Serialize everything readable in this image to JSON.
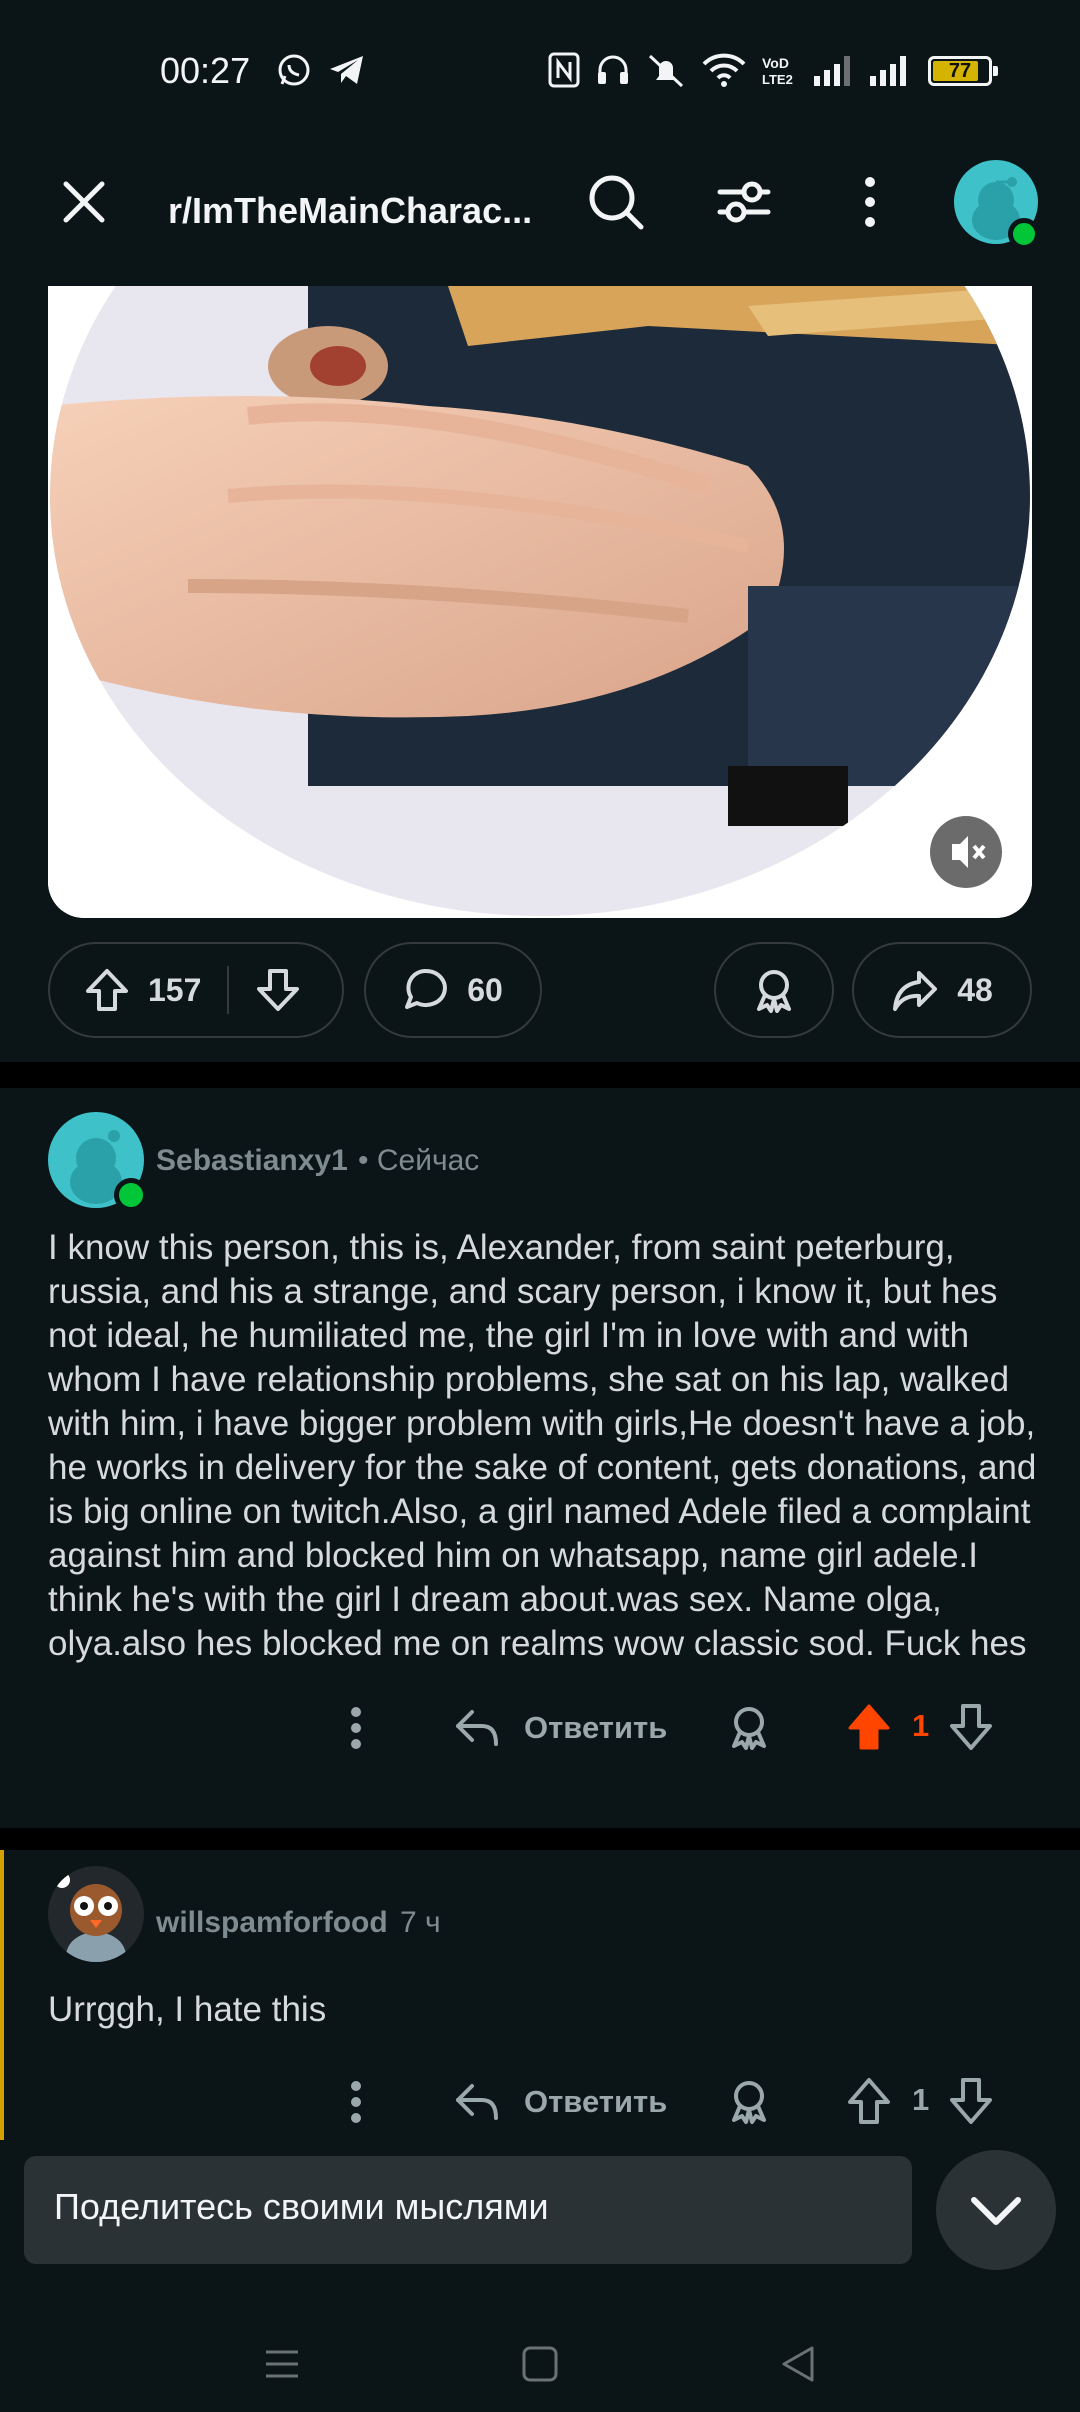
{
  "status_bar": {
    "time": "00:27",
    "battery": "77",
    "icons": [
      "whatsapp-icon",
      "telegram-icon",
      "nfc-icon",
      "headphones-icon",
      "mute-icon",
      "wifi-icon",
      "volte-icon",
      "signal-icon",
      "signal-icon",
      "battery-icon"
    ]
  },
  "header": {
    "title": "r/ImTheMainCharac..."
  },
  "post_actions": {
    "upvotes": "157",
    "comments": "60",
    "shares": "48"
  },
  "comments": [
    {
      "username": "Sebastianxy1",
      "meta": "• Сейчас",
      "text": "I know this person, this is, Alexander, from saint peterburg, russia, and his a strange, and scary person, i know it, but hes not ideal, he humiliated me, the girl I'm in love with and with whom I have relationship problems, she sat on his lap, walked with him, i have bigger problem with girls,He doesn't have a job, he works in delivery for the sake of content, gets donations, and is big online on twitch.Also, a girl named Adele filed a complaint against him and blocked him on whatsapp, name girl adele.I think he's with the girl I dream about.was sex. Name olga, olya.also hes blocked me on realms wow classic sod. Fuck hes",
      "reply_label": "Ответить",
      "score": "1"
    },
    {
      "username": "willspamforfood",
      "meta": "7 ч",
      "text": "Urrggh, I hate this",
      "reply_label": "Ответить",
      "score": "1"
    }
  ],
  "composer": {
    "placeholder": "Поделитесь своими мыслями"
  },
  "colors": {
    "background": "#0b1416",
    "upvote_active": "#ff4500",
    "online": "#00c638",
    "avatar_teal": "#3ec1c9"
  }
}
